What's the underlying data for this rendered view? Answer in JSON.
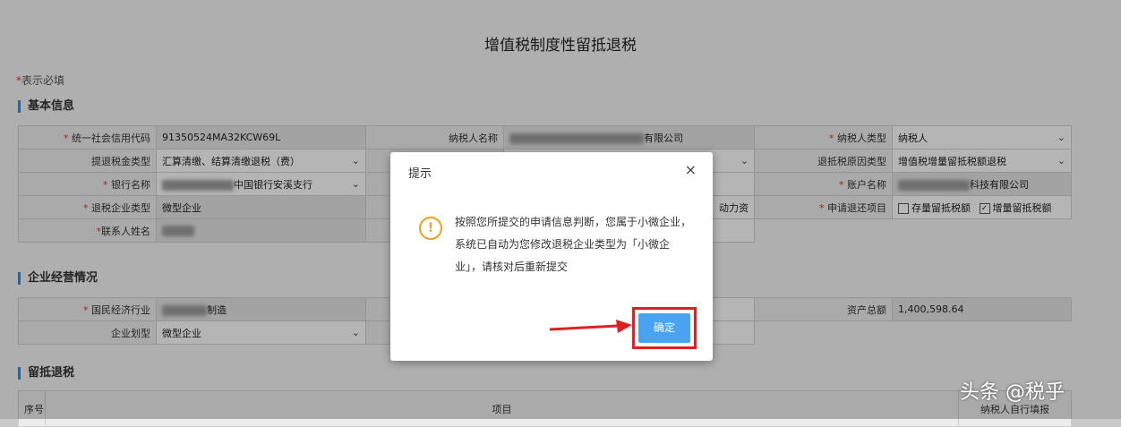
{
  "page": {
    "title": "增值税制度性留抵退税",
    "required_star": "*",
    "required_note": "表示必填"
  },
  "basic_info": {
    "section_title": "基本信息",
    "credit_code_label": "统一社会信用代码",
    "credit_code_value": "91350524MA32KCW69L",
    "taxpayer_name_label": "纳税人名称",
    "taxpayer_name_suffix": "有限公司",
    "taxpayer_type_label": "纳税人类型",
    "taxpayer_type_value": "纳税人",
    "refund_method_label": "提退税金类型",
    "refund_method_value": "汇算清缴、结算清缴退税（费）",
    "refund_reason_label": "退抵税原因类型",
    "refund_reason_value": "增值税增量留抵税额退税",
    "bank_name_label": "银行名称",
    "bank_name_suffix": "中国银行安溪支行",
    "account_name_label": "账户名称",
    "account_name_suffix": "科技有限公司",
    "enterprise_type_label": "退税企业类型",
    "enterprise_type_value": "微型企业",
    "partial_text": "动力资",
    "refund_item_label": "申请退还项目",
    "option_stock": "存量留抵税额",
    "option_incremental": "增量留抵税额",
    "contact_label": "联系人姓名"
  },
  "operations": {
    "section_title": "企业经营情况",
    "industry_label": "国民经济行业",
    "industry_suffix": "制造",
    "total_assets_label": "资产总额",
    "total_assets_value": "1,400,598.64",
    "enterprise_scale_label": "企业划型",
    "enterprise_scale_value": "微型企业"
  },
  "retention": {
    "section_title": "留抵退税",
    "col_seq": "序号",
    "col_item": "项目",
    "col_last": "纳税人自行填报"
  },
  "dialog": {
    "title": "提示",
    "close": "×",
    "icon": "!",
    "message": "按照您所提交的申请信息判断，您属于小微企业，系统已自动为您修改退税企业类型为「小微企业」，请核对后重新提交",
    "ok_label": "确定"
  },
  "watermark": "头条 @税乎",
  "colors": {
    "primary_button": "#4aa3f0",
    "highlight_frame": "#e02020",
    "warning_icon": "#f0a020",
    "section_accent": "#3b8bd9"
  }
}
